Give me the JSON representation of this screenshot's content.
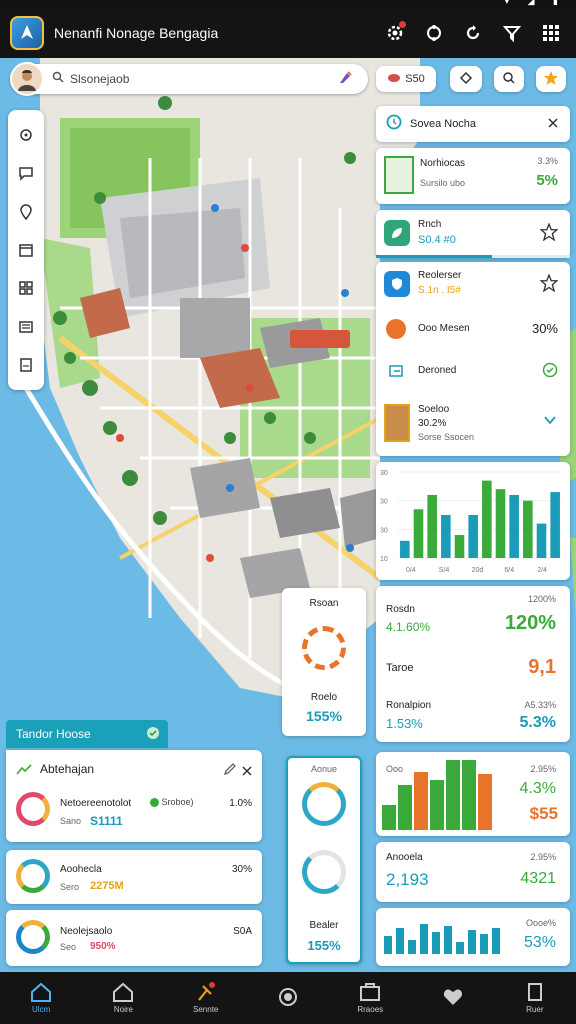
{
  "app": {
    "title": "Nenanfi Nonage Bengagia"
  },
  "search": {
    "value": "Slsonejaob"
  },
  "top_pills": {
    "count_label": "S50"
  },
  "right_panel": {
    "header_title": "Sovea Nocha",
    "item1": {
      "title": "Norhiocas",
      "sub": "Sursilo ubo",
      "pct_top": "3.3%",
      "value": "5%"
    },
    "item2": {
      "title": "Rnch",
      "sub": "S0.4 #0"
    },
    "item3": {
      "title": "Reolerser",
      "sub": "S.1n . I5# "
    },
    "item4": {
      "title": "Ooo Mesen",
      "value": "30%"
    },
    "item5": {
      "title": "Deroned"
    },
    "item6": {
      "title": "Soeloo",
      "sub1": "30.2%",
      "sub2": "Sorse Ssocen"
    }
  },
  "bar_chart": {
    "tick_labels": [
      "30",
      "30",
      "30",
      "10"
    ],
    "x_labels": [
      "0/4",
      "S/4",
      "20d",
      "6/4",
      "2/4"
    ]
  },
  "chart_data": {
    "type": "bar",
    "categories": [
      "",
      "",
      "",
      "",
      "",
      "",
      "",
      "",
      "",
      "",
      "",
      ""
    ],
    "values": [
      6,
      17,
      22,
      15,
      8,
      15,
      27,
      24,
      22,
      20,
      12,
      23
    ],
    "ylim": [
      0,
      30
    ]
  },
  "stats_card_1": {
    "title": "Rosdn",
    "value_a": "4.1.60%",
    "value_b": "1200%",
    "big": "120%",
    "row2_title": "Taroe",
    "row2_value": "9,1",
    "row3_title": "Ronalpion",
    "row3_value_a": "1.53%",
    "row3_sub": "A5.33%",
    "row3_big": "5.3%"
  },
  "donut_card": {
    "title": "Rsoan",
    "bottom_title": "Roelo",
    "bottom_value": "155%"
  },
  "left_tab": {
    "label": "Tandor Hoose"
  },
  "left_list": {
    "header": "Abtehajan",
    "items": [
      {
        "title": "Netoereenotolot",
        "tag": "Sroboe)",
        "sub": "Sano",
        "value_colored": "S1111",
        "pct": "1.0%"
      },
      {
        "title": "Aoohecla",
        "sub": "Sero",
        "value_colored": "2275M",
        "pct": "30%"
      },
      {
        "title": "Neolejsaolo",
        "sub": "Seo",
        "value_colored": "950%",
        "pct": "S0A"
      }
    ]
  },
  "mid_donut_card": {
    "top_label": "Aonue",
    "bottom_title": "Bealer",
    "bottom_value": "155%"
  },
  "bottom_right": {
    "card1": {
      "label": "Ooo",
      "pct": "2.95%",
      "value_a": "4.3%",
      "value_b": "$55"
    },
    "card2": {
      "title": "Anooela",
      "pct": "2.95%",
      "big_a": "2,193",
      "big_b": "4321"
    },
    "card3": {
      "label": "Oooe%",
      "value": "53%"
    }
  },
  "bottom_nav": {
    "items": [
      "Ulcm",
      "Noire",
      "Sennte",
      "",
      "Rraoes",
      "",
      "Ruer"
    ]
  }
}
